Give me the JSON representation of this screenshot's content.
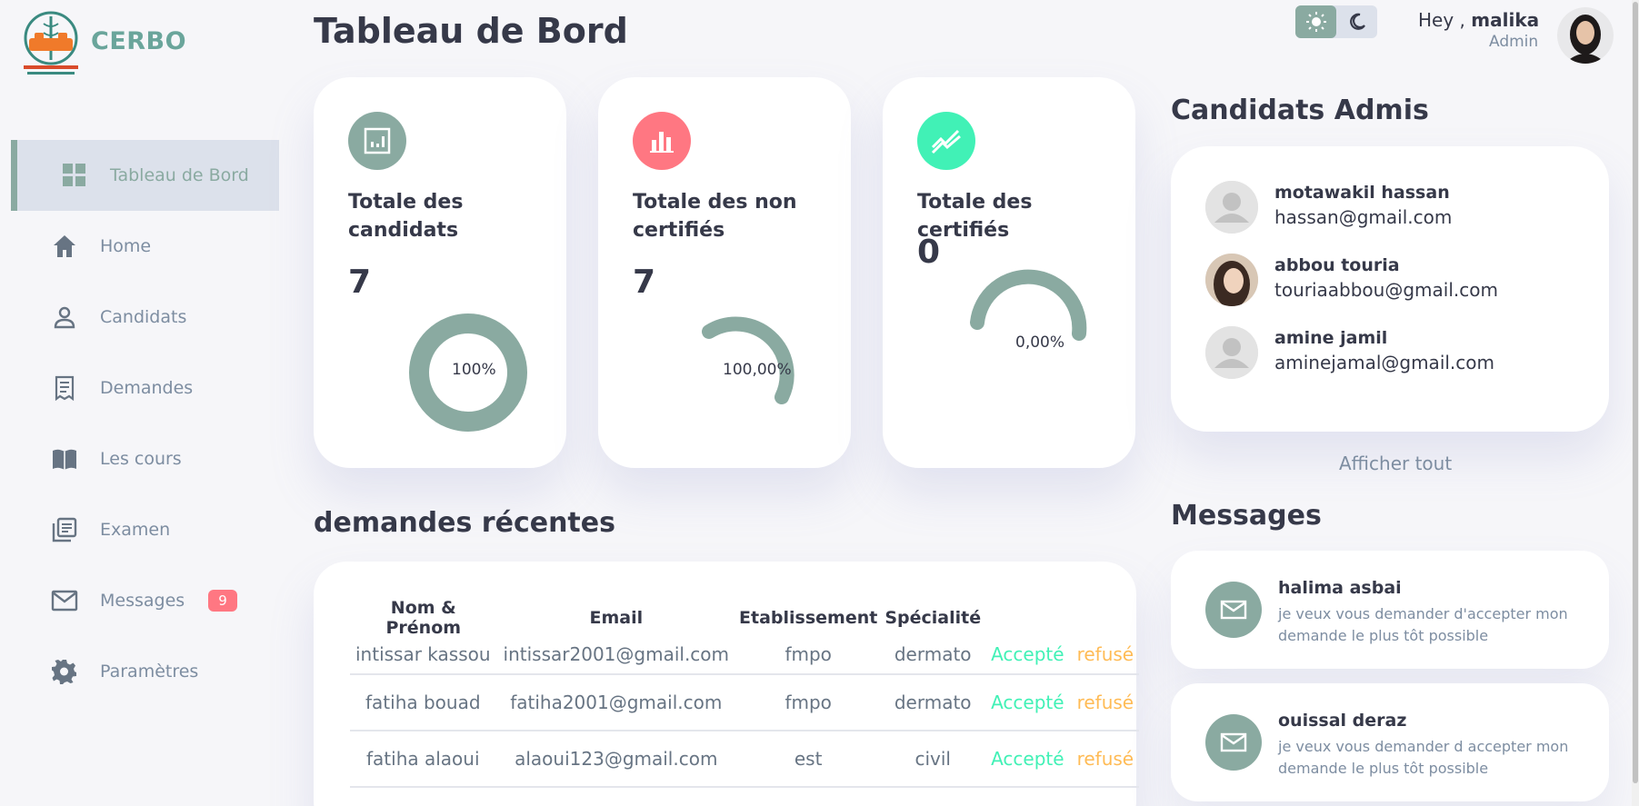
{
  "brand": {
    "name": "CERBO"
  },
  "sidebar": {
    "items": [
      {
        "label": "Tableau de Bord",
        "icon": "dashboard-icon"
      },
      {
        "label": "Home",
        "icon": "home-icon"
      },
      {
        "label": "Candidats",
        "icon": "person-icon"
      },
      {
        "label": "Demandes",
        "icon": "receipt-icon"
      },
      {
        "label": "Les cours",
        "icon": "book-icon"
      },
      {
        "label": "Examen",
        "icon": "list-icon"
      },
      {
        "label": "Messages",
        "icon": "mail-icon",
        "badge": "9"
      },
      {
        "label": "Paramètres",
        "icon": "gear-icon"
      }
    ]
  },
  "header": {
    "title": "Tableau de Bord",
    "greeting": "Hey ,",
    "user": "malika",
    "role": "Admin"
  },
  "cards": [
    {
      "title": "Totale des candidats",
      "value": "7",
      "gauge_label": "100%",
      "icon_color": "#8aaaa1"
    },
    {
      "title": "Totale des non certifiés",
      "value": "7",
      "gauge_label": "100,00%",
      "icon_color": "#ff7782"
    },
    {
      "title": "Totale des certifiés",
      "value": "0",
      "gauge_label": "0,00%",
      "icon_color": "#41f1b6"
    }
  ],
  "recent": {
    "title": "demandes récentes",
    "headers": [
      "Nom & Prénom",
      "Email",
      "Etablissement",
      "Spécialité"
    ],
    "rows": [
      {
        "name": "intissar kassou",
        "email": "intissar2001@gmail.com",
        "etab": "fmpo",
        "spec": "dermato",
        "accept": "Accepté",
        "refuse": "refusé"
      },
      {
        "name": "fatiha bouad",
        "email": "fatiha2001@gmail.com",
        "etab": "fmpo",
        "spec": "dermato",
        "accept": "Accepté",
        "refuse": "refusé"
      },
      {
        "name": "fatiha alaoui",
        "email": "alaoui123@gmail.com",
        "etab": "est",
        "spec": "civil",
        "accept": "Accepté",
        "refuse": "refusé"
      }
    ]
  },
  "admis": {
    "title": "Candidats Admis",
    "items": [
      {
        "name": "motawakil hassan",
        "email": "hassan@gmail.com"
      },
      {
        "name": "abbou touria",
        "email": "touriaabbou@gmail.com"
      },
      {
        "name": "amine jamil",
        "email": "aminejamal@gmail.com"
      }
    ],
    "show_all": "Afficher tout"
  },
  "messages": {
    "title": "Messages",
    "items": [
      {
        "name": "halima asbai",
        "text": "je veux vous demander d'accepter mon demande le plus tôt possible"
      },
      {
        "name": "ouissal deraz",
        "text": "je veux vous demander d accepter mon demande le plus tôt possible"
      }
    ]
  },
  "colors": {
    "primary": "#8aaaa1",
    "danger": "#ff7782",
    "success": "#41f1b6",
    "warning": "#ffbb55"
  }
}
